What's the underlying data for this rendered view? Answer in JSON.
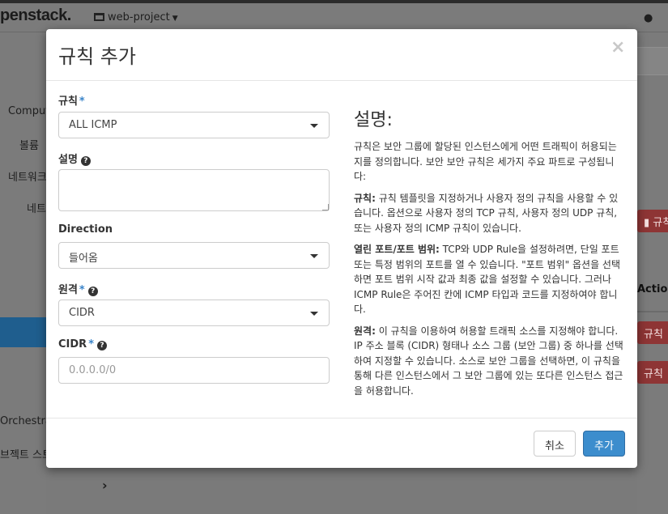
{
  "app": {
    "brand": "penstack.",
    "project_name": "web-project",
    "user_icon": "user-icon"
  },
  "sidebar": {
    "items": [
      {
        "label": "Compute"
      },
      {
        "label": "볼륨"
      },
      {
        "label": "네트워크"
      },
      {
        "label": "네트"
      },
      {
        "label": "Orchestrat"
      },
      {
        "label": "브젝트 스토"
      }
    ]
  },
  "background": {
    "delete_rule_label": "규칙",
    "column_actions": "Action",
    "row_delete_label_1": "규칙",
    "row_delete_label_2": "규칙",
    "chevron": "›"
  },
  "modal": {
    "title": "규칙 추가",
    "close_glyph": "×",
    "fields": {
      "rule": {
        "label": "규칙",
        "required": "*",
        "value": "ALL ICMP"
      },
      "description": {
        "label": "설명",
        "value": ""
      },
      "direction": {
        "label": "Direction",
        "value": "들어옴"
      },
      "remote": {
        "label": "원격",
        "required": "*",
        "value": "CIDR"
      },
      "cidr": {
        "label": "CIDR",
        "required": "*",
        "placeholder": "0.0.0.0/0"
      }
    },
    "help": {
      "title": "설명:",
      "intro": "규칙은 보안 그룹에 할당된 인스턴스에게 어떤 트래픽이 허용되는지를 정의합니다. 보안 보안 규칙은 세가지 주요 파트로 구성됩니다:",
      "rule_heading": "규칙:",
      "rule_text": " 규칙 템플릿을 지정하거나 사용자 정의 규칙을 사용할 수 있습니다. 옵션으로 사용자 정의 TCP 규칙, 사용자 정의 UDP 규칙, 또는 사용자 정의 ICMP 규칙이 있습니다.",
      "ports_heading": "열린 포트/포트 범위:",
      "ports_text": " TCP와 UDP Rule을 설정하려면, 단일 포트 또는 특정 범위의 포트를 열 수 있습니다. \"포트 범위\" 옵션을 선택하면 포트 범위 시작 값과 최종 값을 설정할 수 있습니다. 그러나 ICMP Rule은 주어진 칸에 ICMP 타입과 코드를 지정하여야 합니다.",
      "remote_heading": "원격:",
      "remote_text": " 이 규칙을 이용하여 허용할 트래픽 소스를 지정해야 합니다. IP 주소 블록 (CIDR) 형태나 소스 그룹 (보안 그룹) 중 하나를 선택하여 지정할 수 있습니다. 소스로 보안 그룹을 선택하면, 이 규칙을 통해 다른 인스턴스에서 그 보안 그룹에 있는 또다른 인스턴스 접근을 허용합니다."
    },
    "footer": {
      "cancel_label": "취소",
      "add_label": "추가"
    }
  },
  "colors": {
    "primary": "#3c8dcd",
    "required_star": "#3a84c9",
    "danger_dimmed": "#8e3535",
    "sidebar_active_dimmed": "#1f5e8e"
  }
}
